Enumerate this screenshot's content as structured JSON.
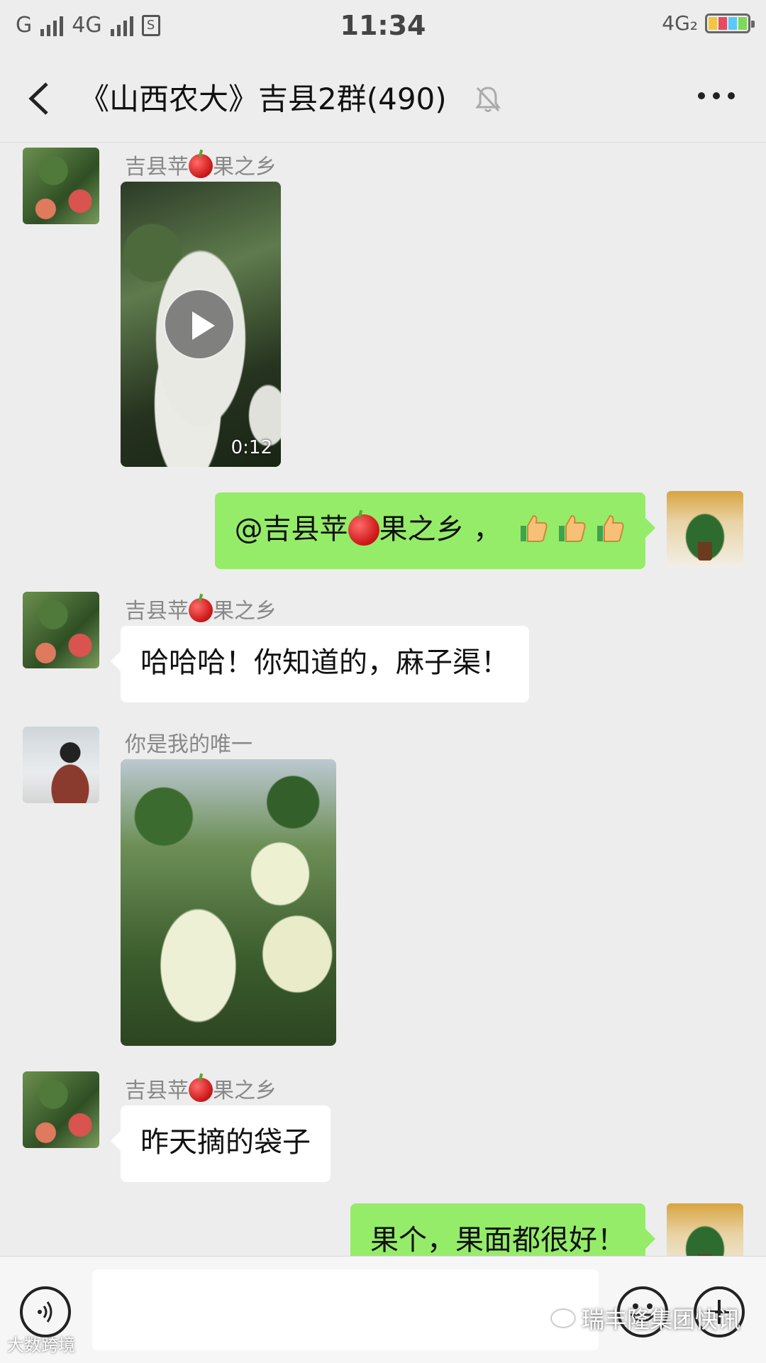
{
  "status_bar": {
    "left_signal_1": "G",
    "left_signal_2": "4G",
    "sim_badge": "S",
    "time": "11:34",
    "right_network": "4G₂",
    "battery_colors": [
      "#f5c542",
      "#e84a5f",
      "#5ac8fa",
      "#7ed957"
    ]
  },
  "nav": {
    "title": "《山西农大》吉县2群(490)",
    "back_icon": "chevron-left-icon",
    "mute_icon": "bell-muted-icon",
    "more_icon": "more-dots-icon"
  },
  "messages": [
    {
      "type": "video",
      "sender_prefix": "吉县苹",
      "sender_suffix": "果之乡",
      "duration": "0:12"
    },
    {
      "type": "text-out",
      "text_prefix": "@吉县苹",
      "text_suffix": "果之乡 ，"
    },
    {
      "type": "text-in",
      "sender_prefix": "吉县苹",
      "sender_suffix": "果之乡",
      "text": "哈哈哈！你知道的，麻子渠！"
    },
    {
      "type": "image",
      "sender": "你是我的唯一"
    },
    {
      "type": "text-in",
      "sender_prefix": "吉县苹",
      "sender_suffix": "果之乡",
      "text": "昨天摘的袋子"
    },
    {
      "type": "text-out",
      "text": "果个，果面都很好！"
    }
  ],
  "input_bar": {
    "value": "",
    "placeholder": ""
  },
  "watermarks": {
    "left": "大数跨境",
    "right": "瑞丰隆集团快讯"
  }
}
